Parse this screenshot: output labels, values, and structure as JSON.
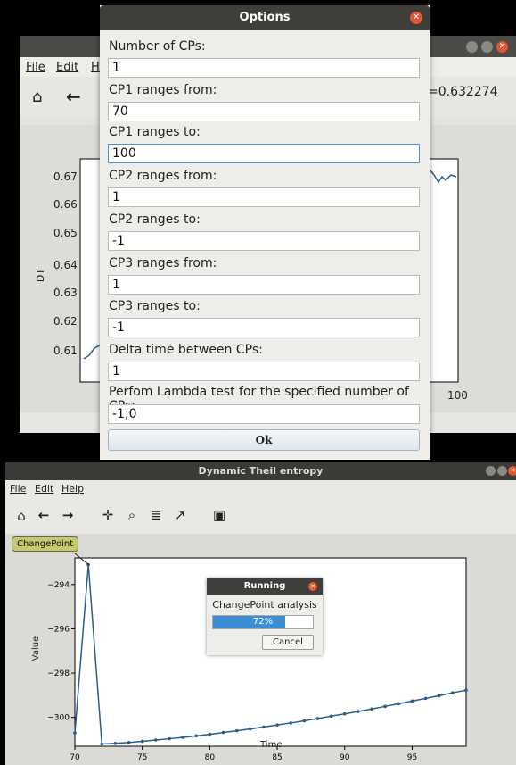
{
  "top_window": {
    "menu": [
      "File",
      "Edit",
      "H"
    ],
    "coord_readout": "=0.632274",
    "plot": {
      "ylabel": "DT",
      "yticks": [
        "0.67",
        "0.66",
        "0.65",
        "0.64",
        "0.63",
        "0.62",
        "0.61"
      ],
      "xtick_right": "100"
    }
  },
  "options_dialog": {
    "title": "Options",
    "fields": [
      {
        "label": "Number of CPs:",
        "value": "1"
      },
      {
        "label": "CP1 ranges from:",
        "value": "70"
      },
      {
        "label": "CP1 ranges to:",
        "value": "100"
      },
      {
        "label": "CP2 ranges from:",
        "value": "1"
      },
      {
        "label": "CP2 ranges to:",
        "value": "-1"
      },
      {
        "label": "CP3 ranges from:",
        "value": "1"
      },
      {
        "label": "CP3 ranges to:",
        "value": "-1"
      },
      {
        "label": "Delta time between CPs:",
        "value": "1"
      },
      {
        "label": "Perfom Lambda test for the specified number of CPs:",
        "value": "-1;0"
      }
    ],
    "ok_label": "Ok"
  },
  "main_window": {
    "title": "Dynamic Theil entropy",
    "menu": [
      "File",
      "Edit",
      "Help"
    ],
    "toolbar_icons": [
      "home-icon",
      "back-icon",
      "forward-icon",
      "pan-icon",
      "zoom-icon",
      "configure-subplots-icon",
      "edit-axis-icon",
      "save-icon"
    ],
    "tooltip": "ChangePoint"
  },
  "running_dialog": {
    "title": "Running",
    "message": "ChangePoint analysis",
    "progress_text": "72%",
    "progress_fraction": 0.72,
    "cancel_label": "Cancel"
  },
  "colors": {
    "accent": "#3a8ed1",
    "line": "#2a5d8a",
    "close": "#e1572f"
  },
  "chart_data": {
    "type": "line",
    "title": "",
    "xlabel": "Time",
    "ylabel": "Value",
    "xlim": [
      70,
      99
    ],
    "ylim": [
      -301.3,
      -292.8
    ],
    "xticks": [
      70,
      75,
      80,
      85,
      90,
      95
    ],
    "yticks": [
      -294,
      -296,
      -298,
      -300
    ],
    "x": [
      70,
      71,
      72,
      73,
      74,
      75,
      76,
      77,
      78,
      79,
      80,
      81,
      82,
      83,
      84,
      85,
      86,
      87,
      88,
      89,
      90,
      91,
      92,
      93,
      94,
      95,
      96,
      97,
      98,
      99
    ],
    "y": [
      -300.7,
      -293.1,
      -301.2,
      -301.17,
      -301.13,
      -301.08,
      -301.02,
      -300.96,
      -300.9,
      -300.83,
      -300.76,
      -300.68,
      -300.6,
      -300.52,
      -300.43,
      -300.34,
      -300.25,
      -300.15,
      -300.05,
      -299.94,
      -299.84,
      -299.73,
      -299.62,
      -299.5,
      -299.38,
      -299.26,
      -299.14,
      -299.02,
      -298.89,
      -298.77
    ]
  }
}
